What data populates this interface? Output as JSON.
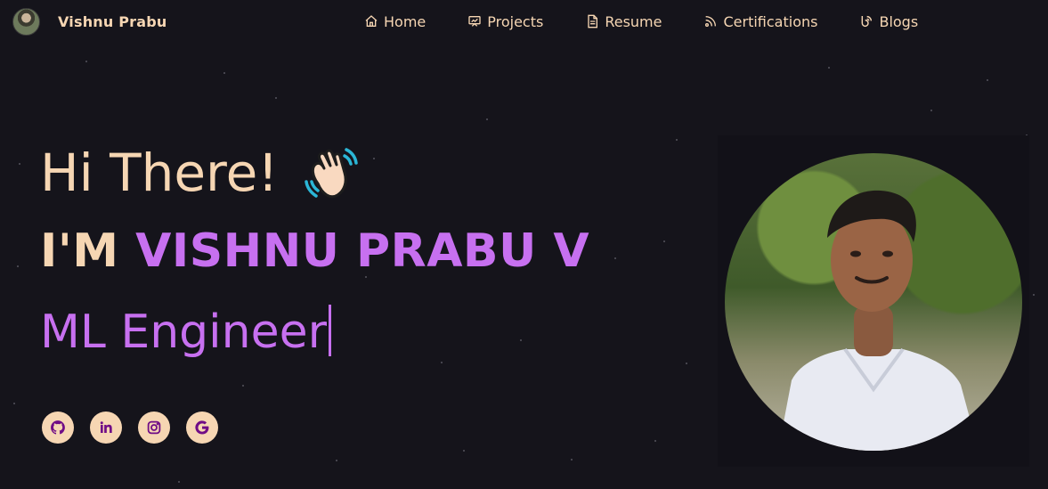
{
  "brand": {
    "name": "Vishnu Prabu"
  },
  "nav": [
    {
      "label": "Home",
      "icon": "home-icon"
    },
    {
      "label": "Projects",
      "icon": "projects-icon"
    },
    {
      "label": "Resume",
      "icon": "resume-icon"
    },
    {
      "label": "Certifications",
      "icon": "certifications-icon"
    },
    {
      "label": "Blogs",
      "icon": "blogs-icon"
    }
  ],
  "hero": {
    "greeting": "Hi There!",
    "name_prefix": "I'M",
    "name": "VISHNU PRABU V",
    "role": "ML Engineer"
  },
  "socials": [
    {
      "icon": "github-icon"
    },
    {
      "icon": "linkedin-icon"
    },
    {
      "icon": "instagram-icon"
    },
    {
      "icon": "google-icon"
    }
  ],
  "colors": {
    "background": "#15141b",
    "accent": "#c770f0",
    "text": "#f6d6b3",
    "icon_bg": "#f6d6b3",
    "icon_fg": "#700c86"
  }
}
